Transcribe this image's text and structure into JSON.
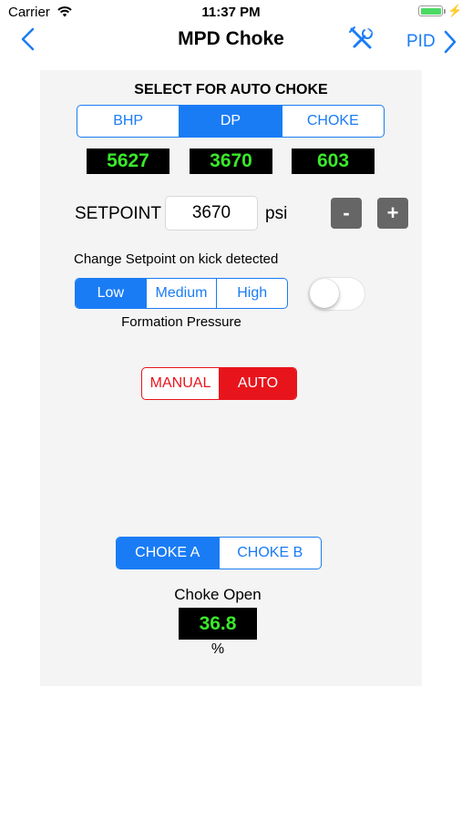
{
  "status_bar": {
    "carrier": "Carrier",
    "time": "11:37 PM"
  },
  "nav": {
    "title": "MPD Choke",
    "right_label": "PID"
  },
  "auto_choke": {
    "heading": "SELECT FOR AUTO CHOKE",
    "options": [
      "BHP",
      "DP",
      "CHOKE"
    ],
    "selected": "DP",
    "readouts": [
      "5627",
      "3670",
      "603"
    ]
  },
  "setpoint": {
    "label": "SETPOINT",
    "value": "3670",
    "unit": "psi",
    "decrement": "-",
    "increment": "+"
  },
  "kick": {
    "label": "Change Setpoint on kick detected",
    "levels": [
      "Low",
      "Medium",
      "High"
    ],
    "selected": "Low",
    "formation_label": "Formation Pressure",
    "toggle_on": false
  },
  "mode": {
    "options": [
      "MANUAL",
      "AUTO"
    ],
    "selected": "AUTO"
  },
  "choke_select": {
    "options": [
      "CHOKE A",
      "CHOKE B"
    ],
    "selected": "CHOKE A"
  },
  "choke_open": {
    "label": "Choke Open",
    "value": "36.8",
    "unit": "%"
  },
  "colors": {
    "accent": "#1a7cf5",
    "danger": "#e8141c",
    "lcd_text": "#39e82a",
    "button_gray": "#666666"
  }
}
